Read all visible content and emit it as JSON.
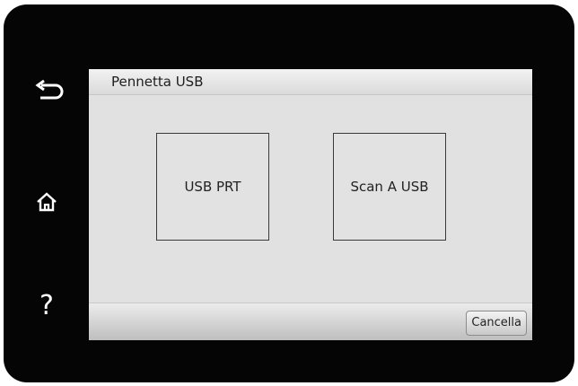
{
  "screen": {
    "title": "Pennetta USB",
    "options": [
      {
        "label": "USB PRT"
      },
      {
        "label": "Scan A USB"
      }
    ],
    "cancel_label": "Cancella"
  },
  "side_buttons": [
    {
      "icon": "back-arrow-icon"
    },
    {
      "icon": "home-icon"
    },
    {
      "icon": "help-icon",
      "glyph": "?"
    }
  ],
  "colors": {
    "bezel": "#050505",
    "screen_bg": "#dddddd",
    "tile_border": "#3a3a3a"
  }
}
